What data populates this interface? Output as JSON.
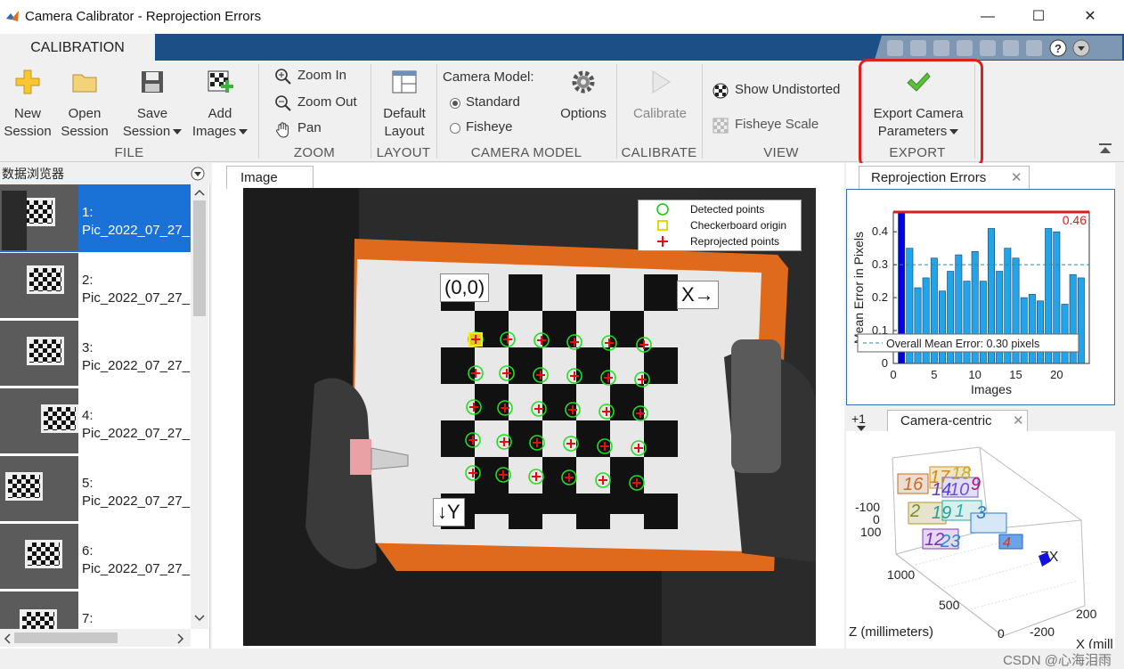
{
  "window": {
    "title": "Camera Calibrator - Reprojection Errors",
    "controls": {
      "minimize": "—",
      "maximize": "☐",
      "close": "✕"
    }
  },
  "ribbon": {
    "tab": "CALIBRATION",
    "file": {
      "label": "FILE",
      "new_session": [
        "New",
        "Session"
      ],
      "open_session": [
        "Open",
        "Session"
      ],
      "save_session": [
        "Save",
        "Session"
      ],
      "add_images": [
        "Add",
        "Images"
      ]
    },
    "zoom": {
      "label": "ZOOM",
      "zoom_in": "Zoom In",
      "zoom_out": "Zoom Out",
      "pan": "Pan"
    },
    "layout": {
      "label": "LAYOUT",
      "default_layout": [
        "Default",
        "Layout"
      ]
    },
    "camera_model": {
      "label": "CAMERA MODEL",
      "title": "Camera Model:",
      "standard": "Standard",
      "fisheye": "Fisheye",
      "options": "Options",
      "selected": "Standard"
    },
    "calibrate": {
      "label": "CALIBRATE",
      "button": "Calibrate"
    },
    "view": {
      "label": "VIEW",
      "show_undistorted": "Show Undistorted",
      "fisheye_scale": "Fisheye Scale"
    },
    "export": {
      "label": "EXPORT",
      "button": [
        "Export Camera",
        "Parameters"
      ]
    }
  },
  "browser": {
    "title": "数据浏览器",
    "items": [
      {
        "label": "1:\nPic_2022_07_27_",
        "selected": true
      },
      {
        "label": "2:\nPic_2022_07_27_"
      },
      {
        "label": "3:\nPic_2022_07_27_"
      },
      {
        "label": "4:\nPic_2022_07_27_"
      },
      {
        "label": "5:\nPic_2022_07_27_"
      },
      {
        "label": "6:\nPic_2022_07_27_"
      },
      {
        "label": "7:\n"
      }
    ]
  },
  "image_panel": {
    "tab": "Image",
    "legend": {
      "detected": "Detected points",
      "origin": "Checkerboard origin",
      "reprojected": "Reprojected points"
    },
    "origin_label": "(0,0)",
    "x_label": "X→",
    "y_label": "↓Y"
  },
  "reprojection": {
    "tab": "Reprojection Errors",
    "chart_data": {
      "type": "bar",
      "xlabel": "Images",
      "ylabel": "Mean Error in Pixels",
      "ylim": [
        0,
        0.46
      ],
      "xticks": [
        "0",
        "5",
        "10",
        "15",
        "20"
      ],
      "yticks": [
        "0",
        "0.1",
        "0.2",
        "0.3",
        "0.4"
      ],
      "values": [
        0.46,
        0.35,
        0.23,
        0.26,
        0.32,
        0.22,
        0.28,
        0.33,
        0.25,
        0.34,
        0.25,
        0.41,
        0.28,
        0.35,
        0.32,
        0.2,
        0.21,
        0.19,
        0.41,
        0.4,
        0.18,
        0.27,
        0.26
      ],
      "selected_index": 0,
      "overall_mean": 0.3,
      "max_line": 0.46,
      "max_label": "0.46",
      "legend": "Overall Mean Error: 0.30 pixels",
      "bar_color": "#1fa5e8",
      "selected_color": "#0000e6",
      "max_line_color": "#e01b1b"
    }
  },
  "camera_centric": {
    "side_tab": "+1",
    "tab": "Camera-centric",
    "y_ticks": [
      "-100",
      "0",
      "100"
    ],
    "z_ticks": [
      "1000",
      "500",
      "0"
    ],
    "x_ticks": [
      "200",
      "-200"
    ],
    "z_label": "Z (millimeters)",
    "x_label": "X (mill",
    "axis_letters": "ZX",
    "board_numbers": [
      "16",
      "17",
      "18",
      "14",
      "10",
      "9",
      "2",
      "19",
      "1",
      "3",
      "12",
      "23",
      "4"
    ]
  },
  "watermark": "CSDN @心海泪雨"
}
